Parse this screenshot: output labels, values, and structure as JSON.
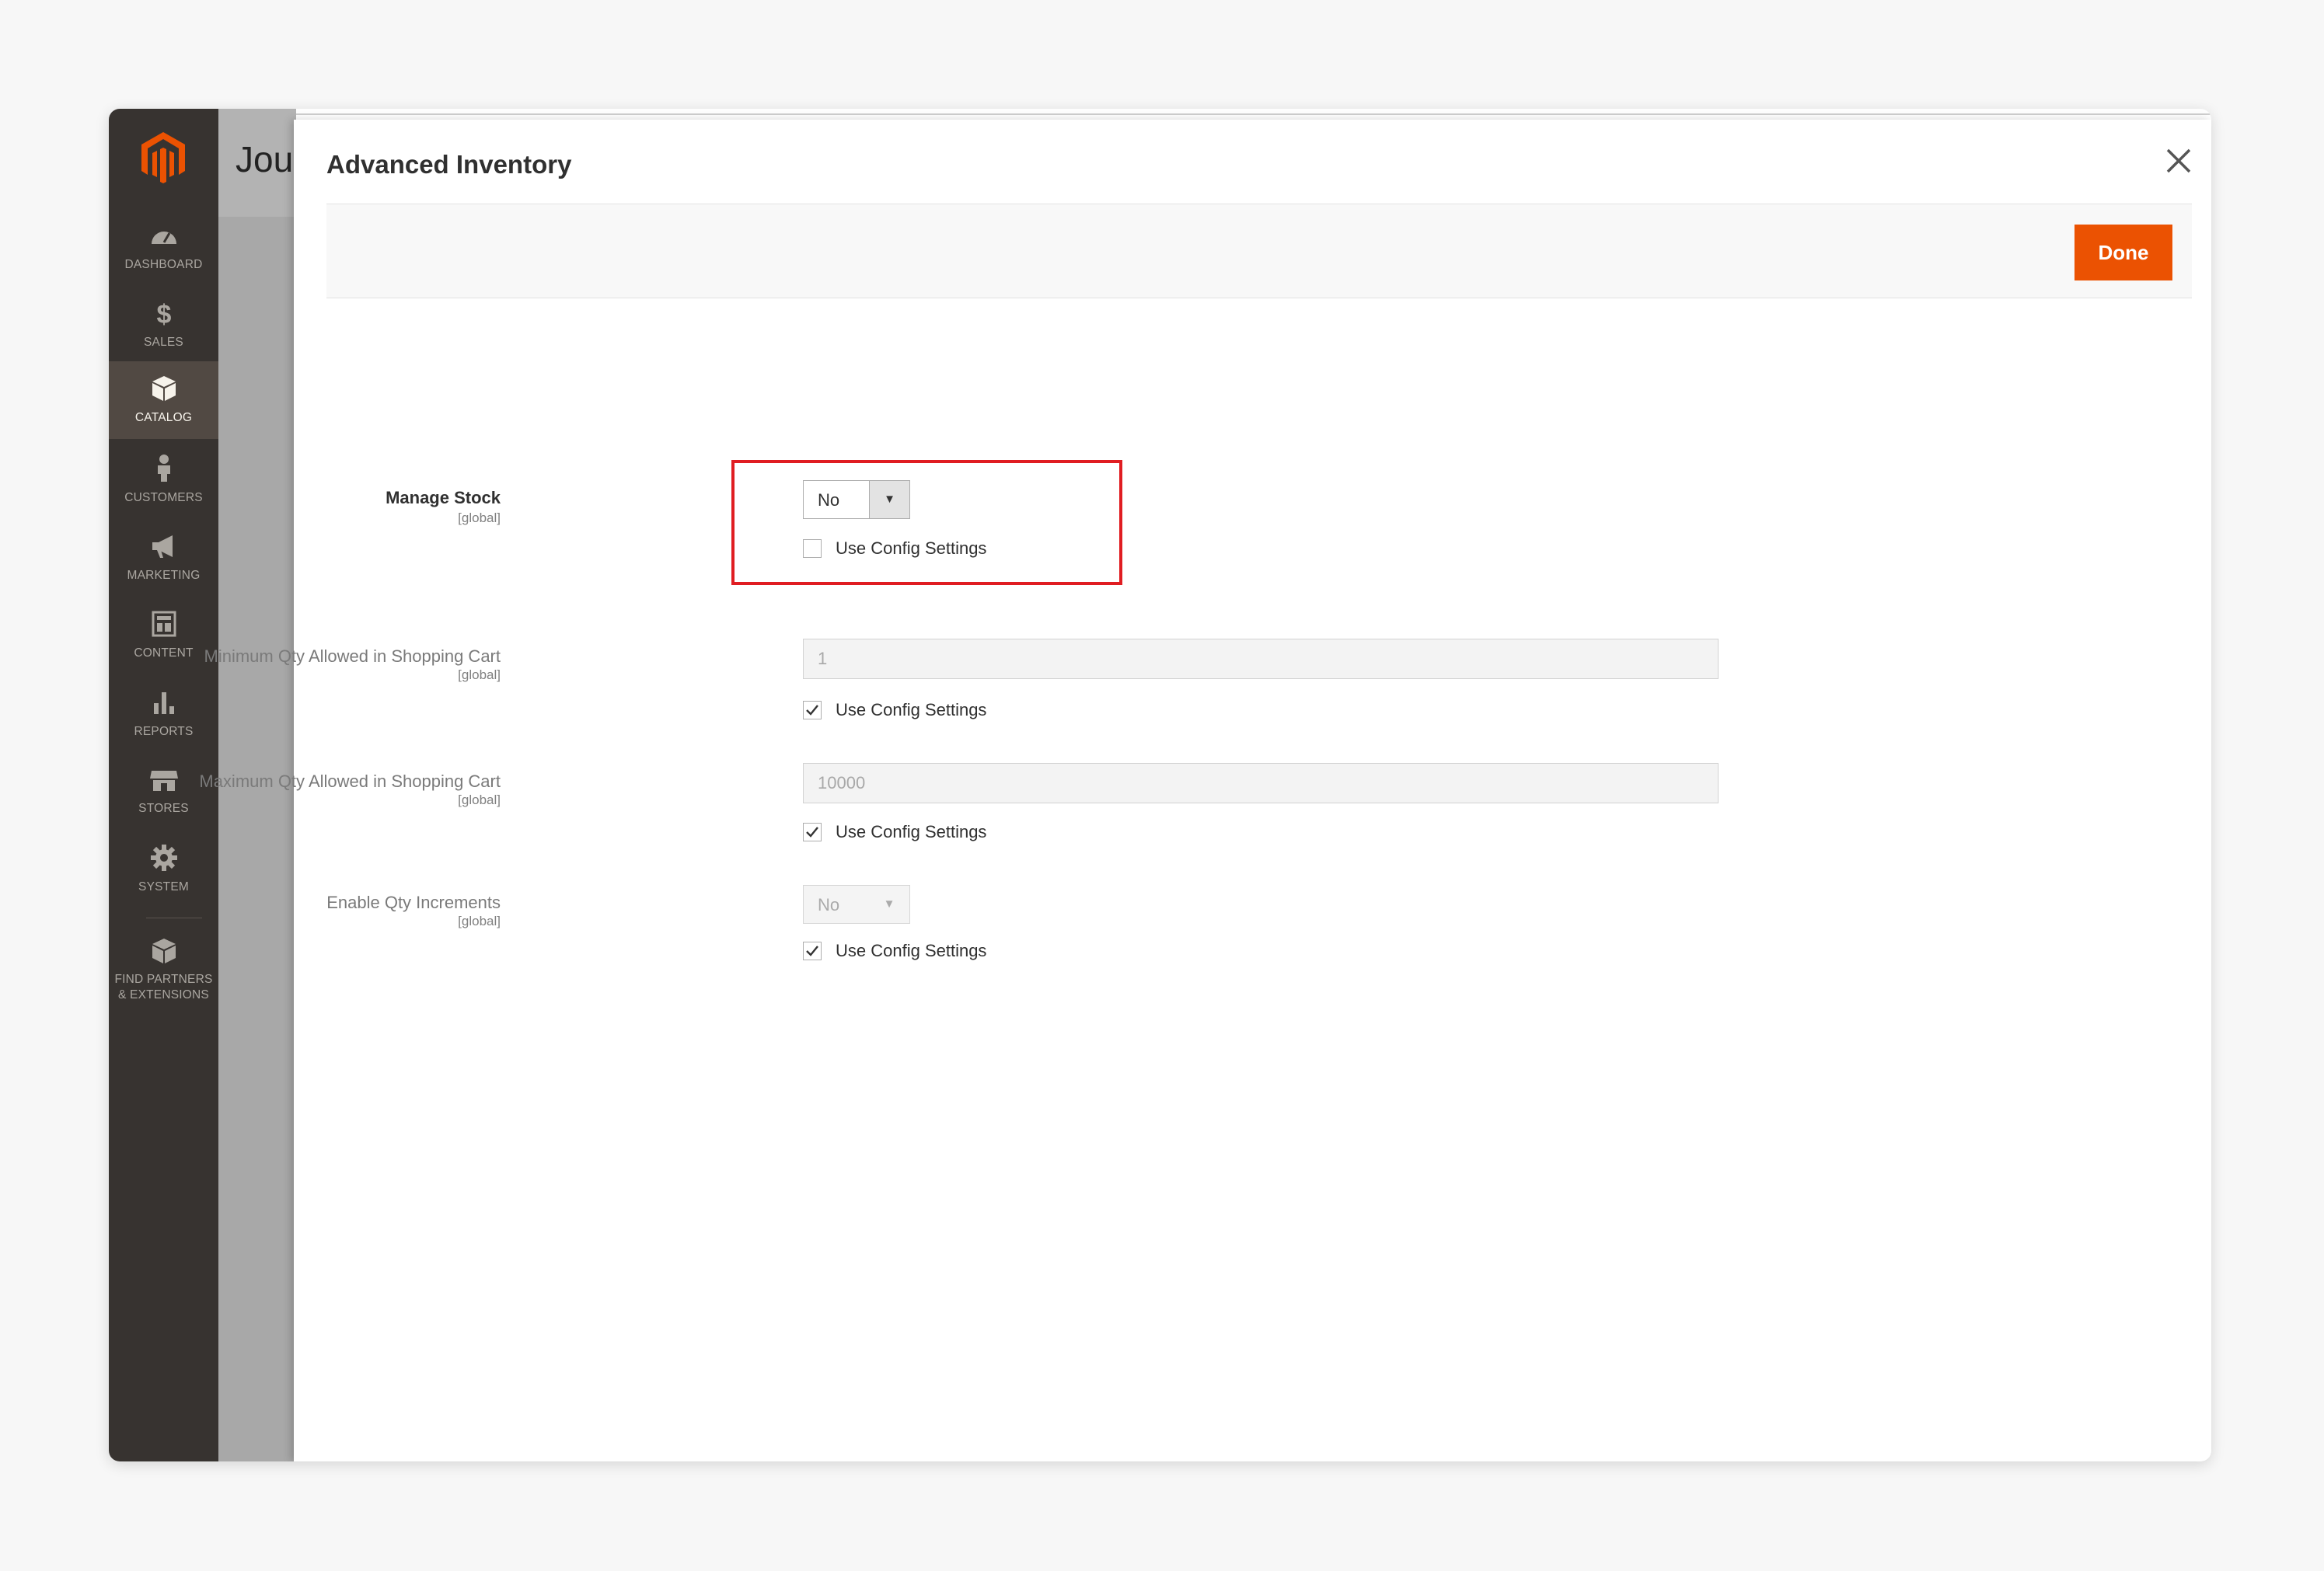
{
  "sidebar": {
    "items": [
      {
        "label": "DASHBOARD",
        "icon": "dashboard-icon"
      },
      {
        "label": "SALES",
        "icon": "dollar-icon"
      },
      {
        "label": "CATALOG",
        "icon": "cube-icon",
        "active": true
      },
      {
        "label": "CUSTOMERS",
        "icon": "person-icon"
      },
      {
        "label": "MARKETING",
        "icon": "megaphone-icon"
      },
      {
        "label": "CONTENT",
        "icon": "layout-icon"
      },
      {
        "label": "REPORTS",
        "icon": "bar-chart-icon"
      },
      {
        "label": "STORES",
        "icon": "storefront-icon"
      },
      {
        "label": "SYSTEM",
        "icon": "gear-icon"
      },
      {
        "label": "FIND PARTNERS & EXTENSIONS",
        "icon": "box-icon"
      }
    ]
  },
  "background_page": {
    "title_fragment": "Jou"
  },
  "modal": {
    "title": "Advanced Inventory",
    "done_label": "Done",
    "fields": {
      "manage_stock": {
        "label": "Manage Stock",
        "scope": "[global]",
        "value": "No",
        "use_config_label": "Use Config Settings",
        "use_config_checked": false
      },
      "min_qty": {
        "label": "Minimum Qty Allowed in Shopping Cart",
        "scope": "[global]",
        "value": "1",
        "use_config_label": "Use Config Settings",
        "use_config_checked": true
      },
      "max_qty": {
        "label": "Maximum Qty Allowed in Shopping Cart",
        "scope": "[global]",
        "value": "10000",
        "use_config_label": "Use Config Settings",
        "use_config_checked": true
      },
      "qty_increments": {
        "label": "Enable Qty Increments",
        "scope": "[global]",
        "value": "No",
        "use_config_label": "Use Config Settings",
        "use_config_checked": true
      }
    }
  },
  "colors": {
    "sidebar_bg": "#373330",
    "accent": "#eb5202",
    "highlight": "#e01d22"
  }
}
